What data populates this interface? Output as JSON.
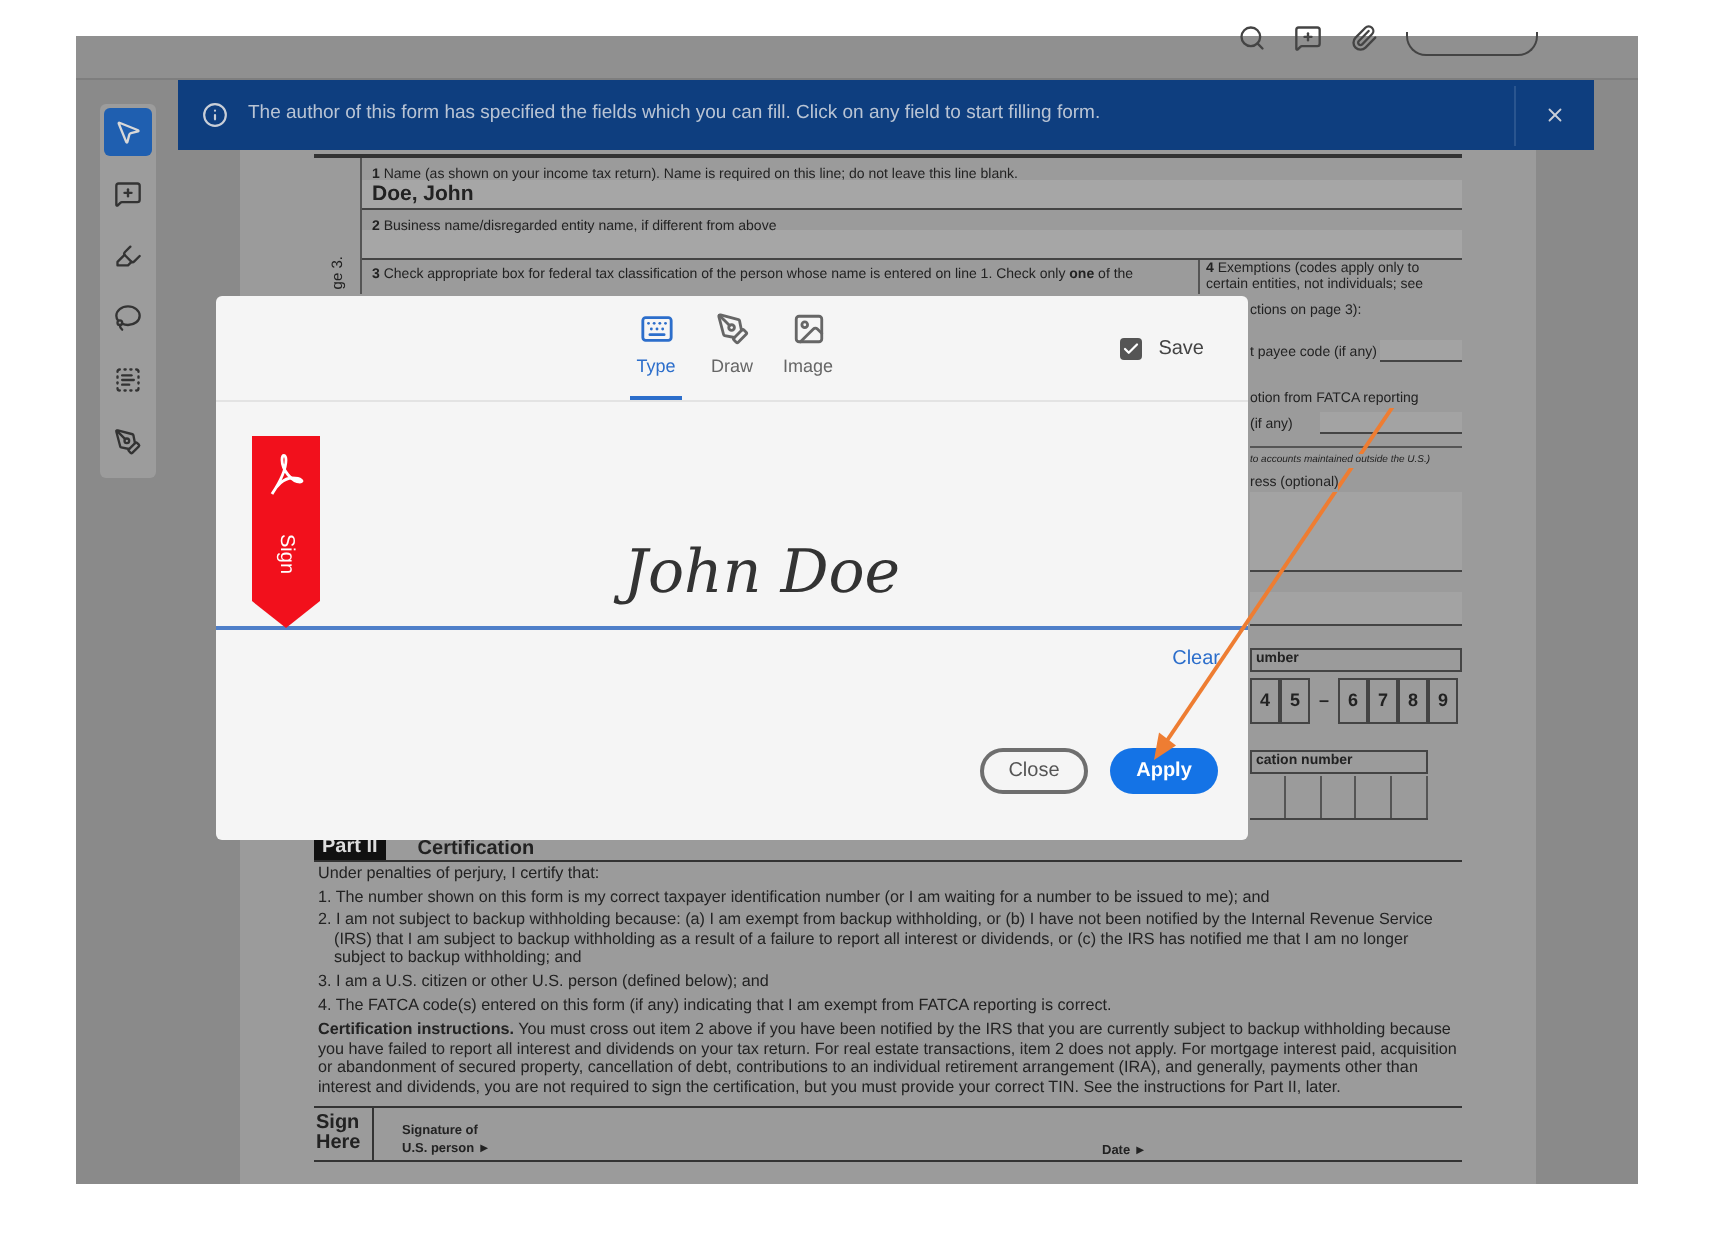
{
  "toolbar": [
    {
      "kind": "select",
      "selected": true
    },
    {
      "kind": "comment",
      "selected": false
    },
    {
      "kind": "highlight",
      "selected": false
    },
    {
      "kind": "lasso",
      "selected": false
    },
    {
      "kind": "text_box",
      "selected": false
    },
    {
      "kind": "sign",
      "selected": false
    }
  ],
  "banner": {
    "message": "The author of this form has specified the fields which you can fill. Click on any field to start filling form."
  },
  "form": {
    "side_label": "ge 3.",
    "line1_label": "**1** Name (as shown on your income tax return). Name is required on this line; do not leave this line blank.",
    "line1_value": "Doe, John",
    "line2_label": "**2** Business name/disregarded entity name, if different from above",
    "line3_label": "**3** Check appropriate box for federal tax classification of the person whose name is entered on line 1. Check only **one** of the",
    "line4_label": "**4** Exemptions (codes apply only to",
    "line4_cont": "certain entities, not individuals; see",
    "exemptions_cont": "ctions on page 3):",
    "payee_code": "t payee code (if any)",
    "fatca": "otion from FATCA reporting",
    "fatca_code": "(if any)",
    "note": "to accounts maintained outside the U.S.)",
    "address": "ress (optional)",
    "ssn_header": "umber",
    "ssn": [
      {
        "kind": "digit",
        "text": "4"
      },
      {
        "kind": "digit",
        "text": "5"
      },
      {
        "kind": "dash",
        "text": "–"
      },
      {
        "kind": "digit",
        "text": "6"
      },
      {
        "kind": "digit",
        "text": "7"
      },
      {
        "kind": "digit",
        "text": "8"
      },
      {
        "kind": "digit",
        "text": "9"
      }
    ],
    "ein_header": "cation number",
    "part_label": "Part II",
    "part_title": "Certification",
    "intro": "Under penalties of perjury, I certify that:",
    "items": [
      "1. The number shown on this form is my correct taxpayer identification number (or I am waiting for a number to be issued to me); and",
      "2. I am not subject to backup withholding because: (a) I am exempt from backup withholding, or (b) I have not been notified by the Internal Revenue Service (IRS) that I am subject to backup withholding as a result of a failure to report all interest or dividends, or (c) the IRS has notified me that I am no longer subject to backup withholding; and",
      "3. I am a U.S. citizen or other U.S. person (defined below); and",
      "4. The FATCA code(s) entered on this form (if any) indicating that I am exempt from FATCA reporting is correct."
    ],
    "instructions": "**Certification instructions.** You must cross out item 2 above if you have been notified by the IRS that you are currently subject to backup withholding because you have failed to report all interest and dividends on your tax return. For real estate transactions, item 2 does not apply. For mortgage interest paid, acquisition or abandonment of secured property, cancellation of debt, contributions to an individual retirement arrangement (IRA), and generally, payments other than interest and dividends, you are not required to sign the certification, but you must provide your correct TIN. See the instructions for Part II, later.",
    "sign_label": "Sign Here",
    "signature_label": "Signature of U.S. person ►",
    "date_label": "Date ►"
  },
  "dialog": {
    "tabs": [
      {
        "kind": "type",
        "label": "Type",
        "selected": true
      },
      {
        "kind": "draw",
        "label": "Draw",
        "selected": false
      },
      {
        "kind": "image",
        "label": "Image",
        "selected": false
      }
    ],
    "save": {
      "label": "Save",
      "checked": true
    },
    "bookmark_label": "Sign",
    "signature": "John Doe",
    "clear": "Clear",
    "buttons": [
      {
        "kind": "secondary",
        "label": "Close"
      },
      {
        "kind": "primary",
        "label": "Apply"
      }
    ]
  }
}
